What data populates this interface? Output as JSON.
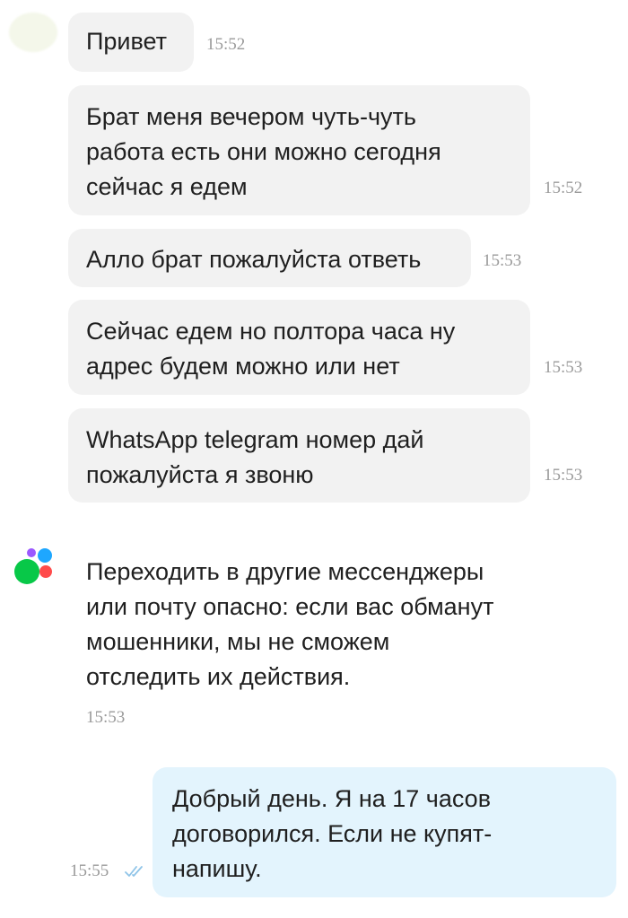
{
  "chat": {
    "messages": [
      {
        "text": "Привет",
        "time": "15:52"
      },
      {
        "text": "Брат меня вечером чуть-чуть\nработа есть они можно сегодня\nсейчас я едем",
        "time": "15:52"
      },
      {
        "text": "Алло брат пожалуйста ответь",
        "time": "15:53"
      },
      {
        "text": "Сейчас едем но полтора часа ну\nадрес будем можно или нет",
        "time": "15:53"
      },
      {
        "text": "WhatsApp telegram номер дай\nпожалуйста я звоню",
        "time": "15:53"
      }
    ],
    "system_notice": {
      "text": "Переходить в другие мессенджеры\nили почту опасно: если вас обманут\nмошенники, мы не сможем\nотследить их действия.",
      "time": "15:53"
    },
    "outgoing": {
      "text": "Добрый день. Я на 17 часов\nдоговорился. Если не купят-\nнапишу.",
      "time": "15:55",
      "status_icon": "double-check-icon"
    }
  },
  "colors": {
    "incoming_bubble": "#f2f2f2",
    "outgoing_bubble": "#e3f4fd",
    "timestamp": "#9a9a9a",
    "read_check": "#8fc4e8",
    "logo_green": "#08c848",
    "logo_red": "#ff4b4b",
    "logo_blue": "#1ea7ff",
    "logo_purple": "#9b58ff"
  }
}
